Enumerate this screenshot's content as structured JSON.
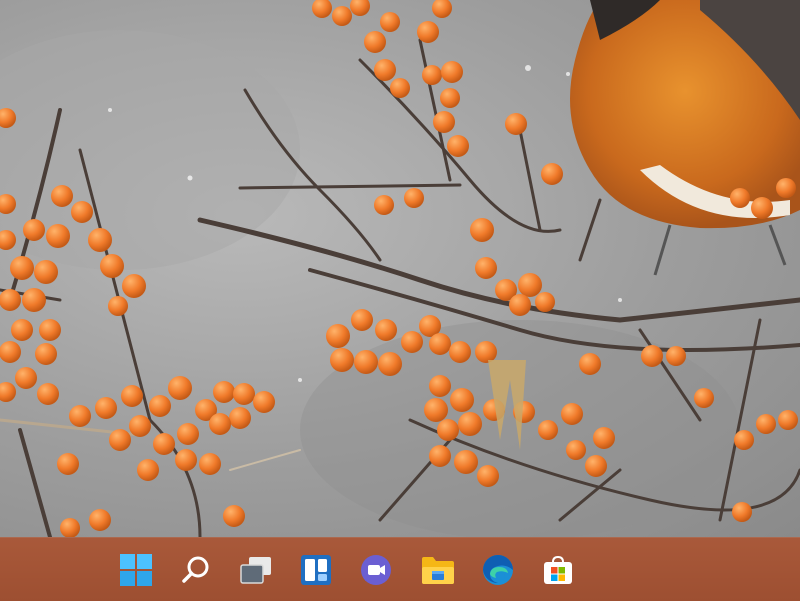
{
  "desktop": {
    "wallpaper": "bird-on-berry-branch"
  },
  "taskbar": {
    "background": "#a35536",
    "items": [
      {
        "name": "start-button",
        "icon": "windows-logo-icon"
      },
      {
        "name": "search-button",
        "icon": "search-icon"
      },
      {
        "name": "task-view-button",
        "icon": "task-view-icon"
      },
      {
        "name": "widgets-button",
        "icon": "widgets-icon"
      },
      {
        "name": "chat-button",
        "icon": "teams-chat-icon"
      },
      {
        "name": "file-explorer-button",
        "icon": "folder-icon"
      },
      {
        "name": "edge-button",
        "icon": "edge-browser-icon"
      },
      {
        "name": "store-button",
        "icon": "microsoft-store-icon"
      }
    ]
  }
}
